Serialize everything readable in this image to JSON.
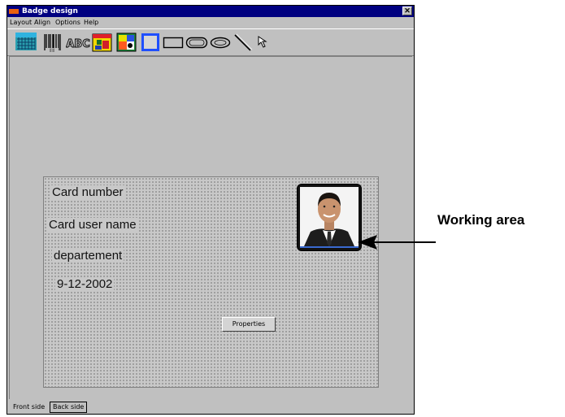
{
  "window": {
    "title": "Badge design",
    "close_glyph": "✕"
  },
  "menu": {
    "items": [
      "Layout",
      "Align",
      "Options",
      "Help"
    ]
  },
  "toolbar": {
    "tools": [
      "barcode-icon",
      "barcode-lines-icon",
      "text-abc-icon",
      "date-icon",
      "image-icon",
      "rectangle-filled-icon",
      "rectangle-icon",
      "rounded-rectangle-icon",
      "ellipse-icon",
      "line-icon",
      "pointer-icon"
    ],
    "text_tool_label": "ABC"
  },
  "card": {
    "fields": {
      "card_number": "Card number",
      "user_name": "Card user name",
      "department": "departement",
      "date": "9-12-2002"
    },
    "properties_button": "Properties"
  },
  "tabs": {
    "front": "Front side",
    "back": "Back side"
  },
  "annotation": {
    "label": "Working area"
  },
  "colors": {
    "titlebar": "#000080",
    "window_bg": "#c0c0c0",
    "accent_blue": "#1f4fff"
  }
}
